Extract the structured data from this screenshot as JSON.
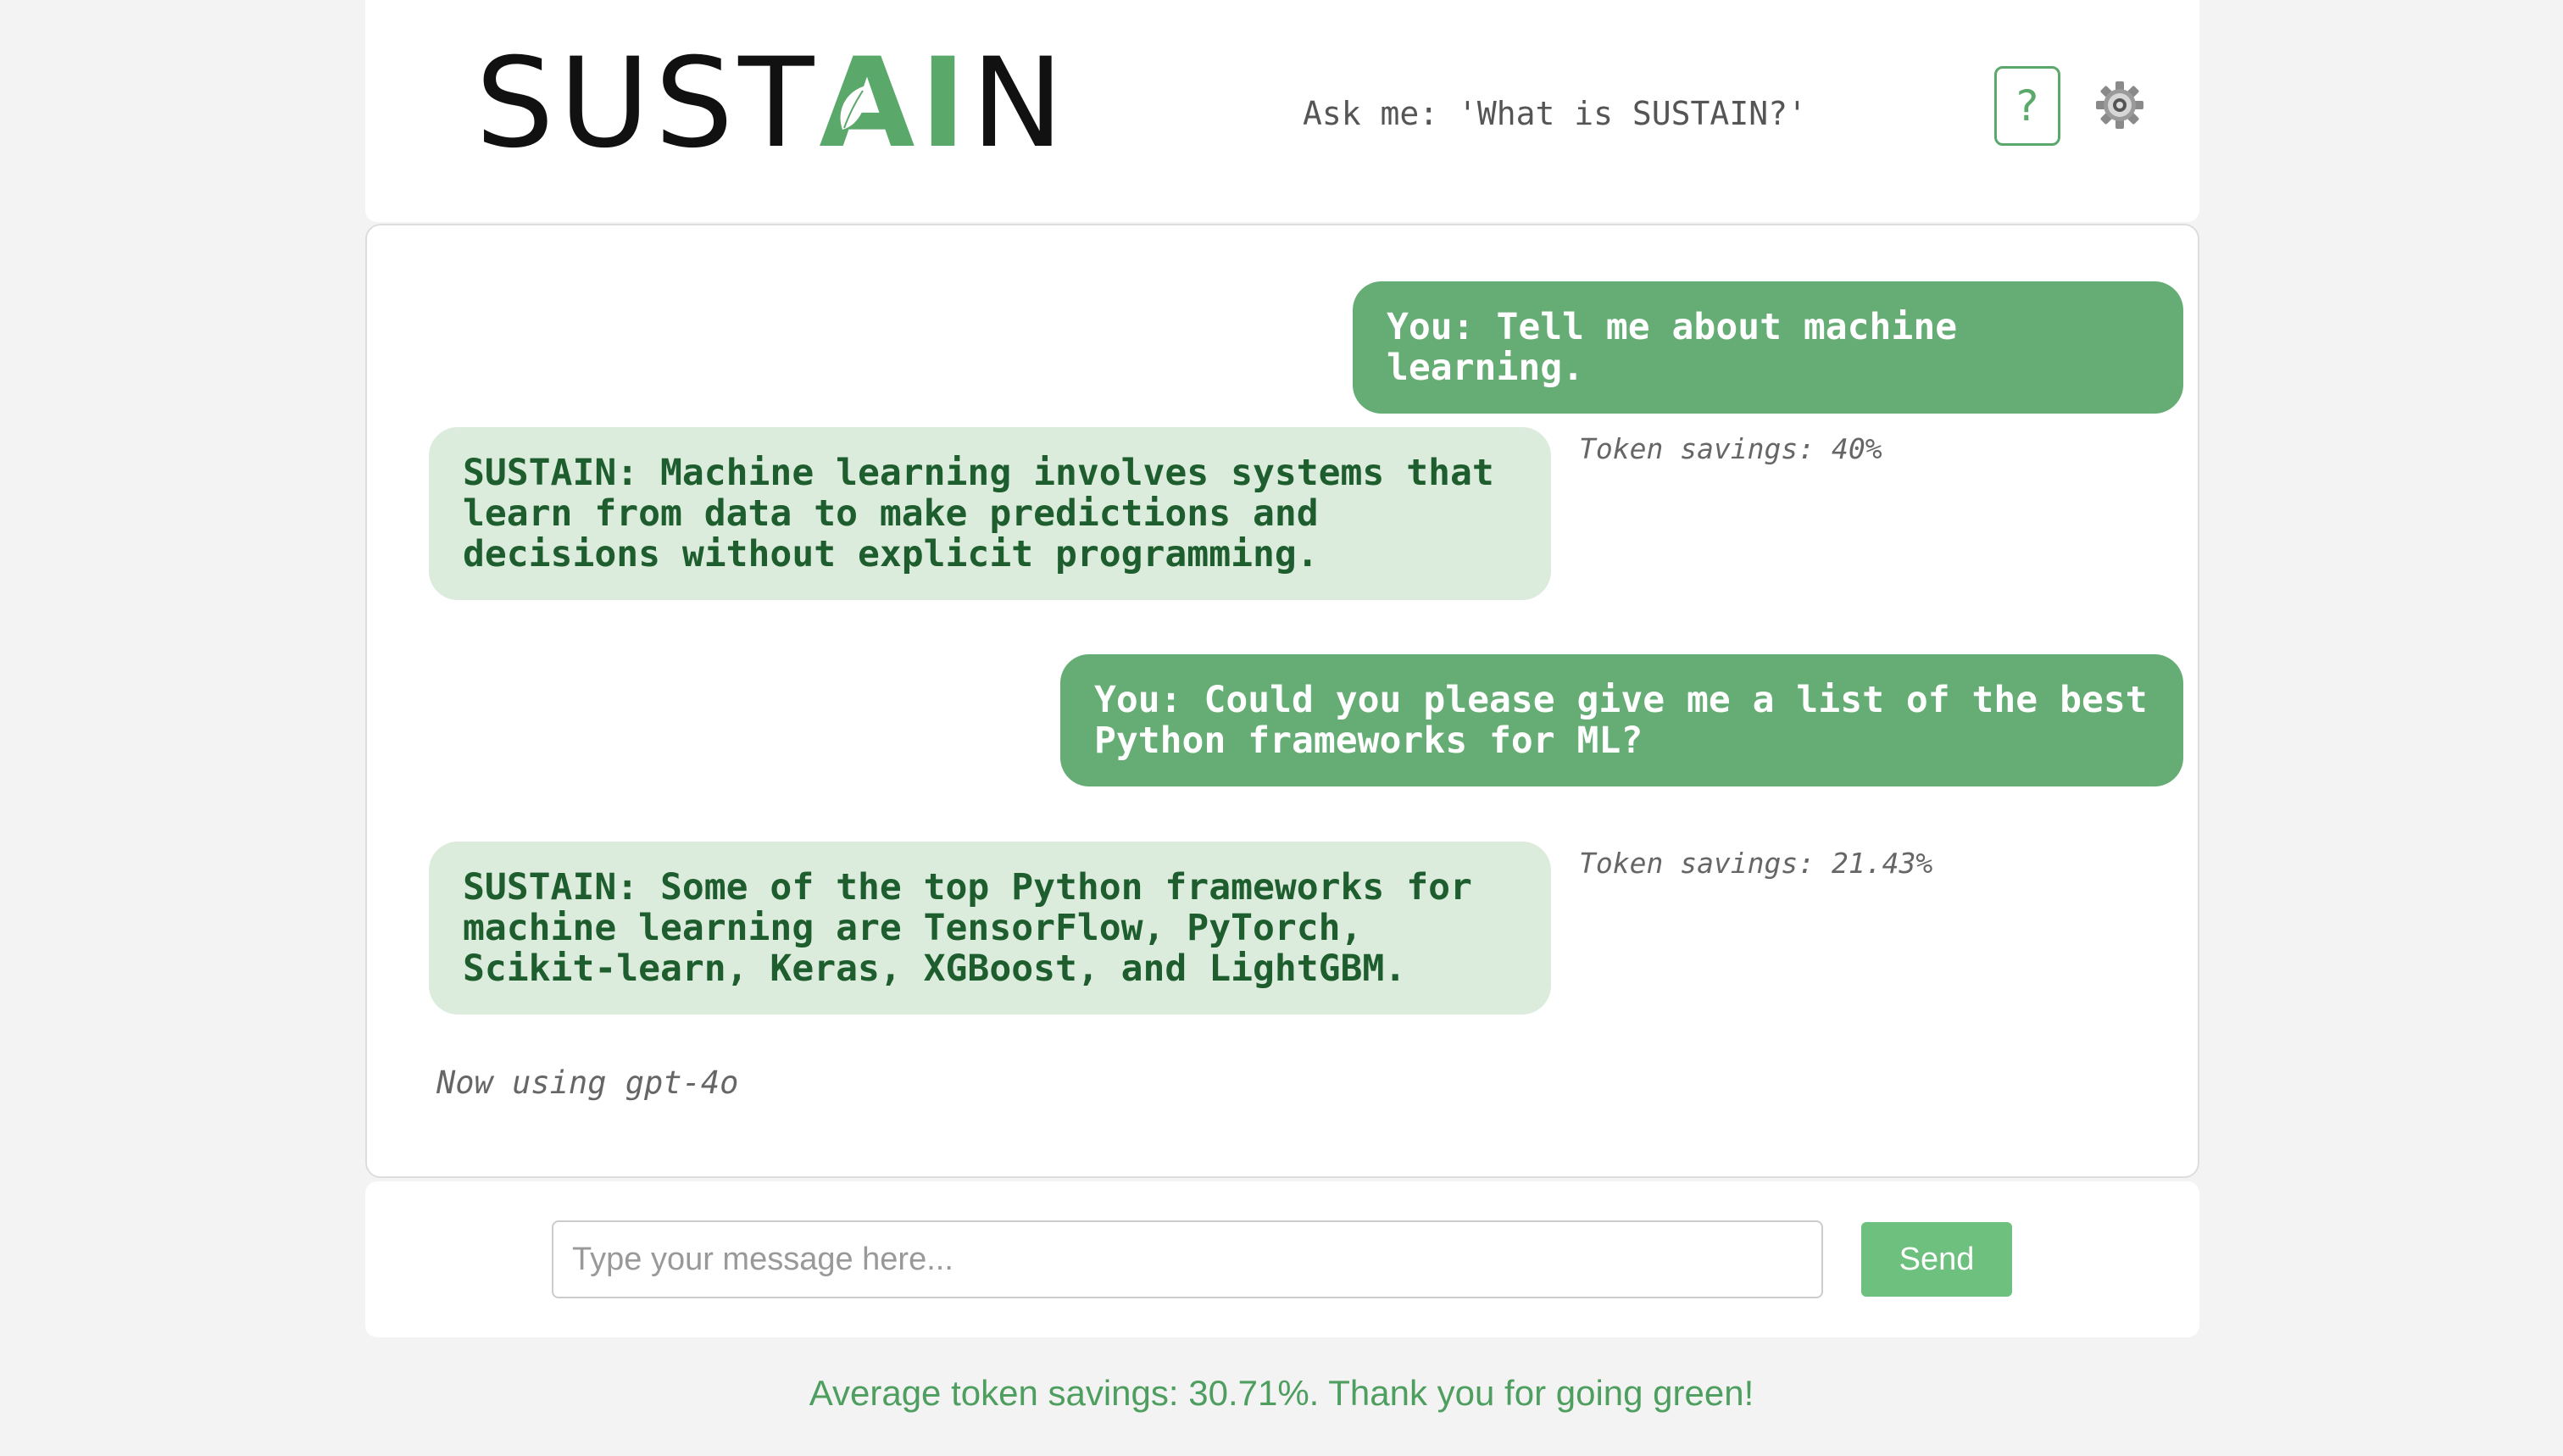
{
  "header": {
    "logo": {
      "prefix": "SUST",
      "highlight": "AI",
      "suffix": "N"
    },
    "ask_prompt": "Ask me: 'What is SUSTAIN?'",
    "help_label": "?",
    "settings_icon": "gear-icon"
  },
  "chat": {
    "messages": [
      {
        "role": "user",
        "text": "You: Tell me about machine learning."
      },
      {
        "role": "bot",
        "text": "SUSTAIN: Machine learning involves systems that learn from data to make predictions and decisions without explicit programming.",
        "token_savings": "Token savings: 40%"
      },
      {
        "role": "user",
        "text": "You: Could you please give me a list of the best Python frameworks for ML?"
      },
      {
        "role": "bot",
        "text": "SUSTAIN: Some of the top Python frameworks for machine learning are TensorFlow, PyTorch, Scikit-learn, Keras, XGBoost, and LightGBM.",
        "token_savings": "Token savings: 21.43%"
      }
    ],
    "model_note": "Now using gpt-4o"
  },
  "input": {
    "placeholder": "Type your message here...",
    "value": "",
    "send_label": "Send"
  },
  "footer": {
    "text": "Average token savings: 30.71%. Thank you for going green!"
  },
  "colors": {
    "brand_green": "#5aa86a",
    "user_bubble": "#65ac75",
    "bot_bubble": "#dbebdc",
    "bot_text": "#1e5d2d",
    "send_button": "#6ec07e"
  }
}
